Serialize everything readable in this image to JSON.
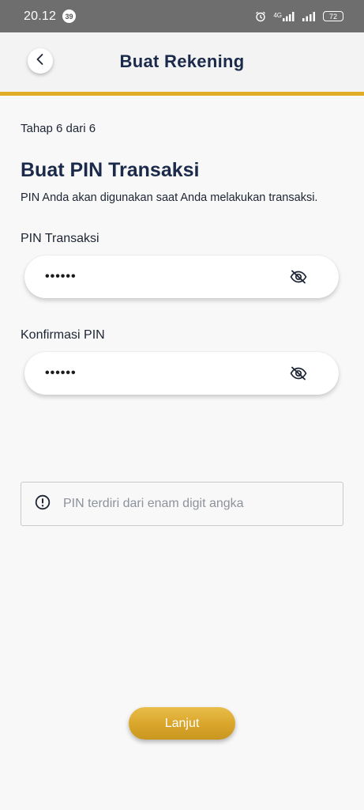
{
  "status_bar": {
    "time": "20.12",
    "notification_count": "39",
    "network": "4G",
    "battery": "72"
  },
  "header": {
    "title": "Buat Rekening",
    "back_icon": "chevron-left-icon",
    "accent_color": "#e1ad27"
  },
  "content": {
    "step": "Tahap 6 dari 6",
    "title": "Buat PIN Transaksi",
    "description": "PIN Anda akan digunakan saat Anda melakukan transaksi.",
    "pin_field": {
      "label": "PIN Transaksi",
      "value": "••••••",
      "toggle_icon": "eye-off-icon"
    },
    "confirm_field": {
      "label": "Konfirmasi PIN",
      "value": "••••••",
      "toggle_icon": "eye-off-icon"
    },
    "info": {
      "icon": "info-circle-icon",
      "text": "PIN terdiri dari enam digit angka"
    }
  },
  "footer": {
    "continue_label": "Lanjut",
    "button_color": "#dcaa2e"
  }
}
